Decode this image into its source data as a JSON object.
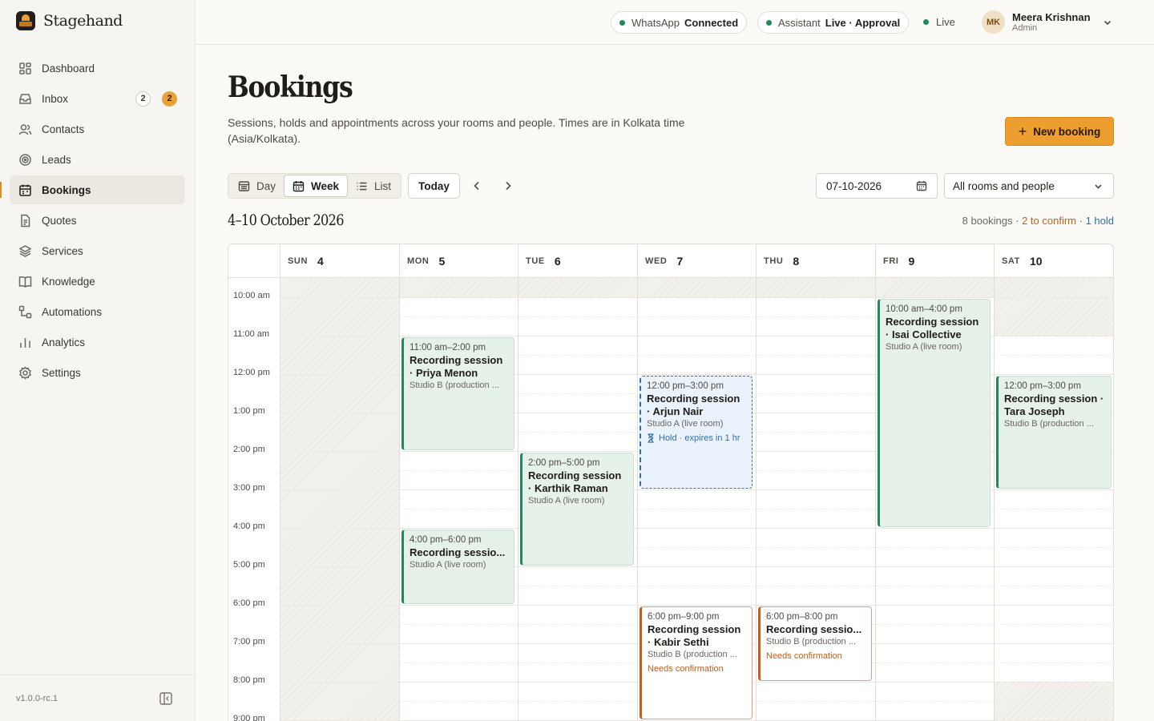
{
  "app": {
    "name": "Stagehand",
    "version": "v1.0.0-rc.1"
  },
  "sidebar": {
    "items": [
      {
        "label": "Dashboard",
        "icon": "dashboard-icon"
      },
      {
        "label": "Inbox",
        "icon": "inbox-icon",
        "badges": [
          "2",
          "2"
        ]
      },
      {
        "label": "Contacts",
        "icon": "contacts-icon"
      },
      {
        "label": "Leads",
        "icon": "target-icon"
      },
      {
        "label": "Bookings",
        "icon": "calendar-icon",
        "active": true
      },
      {
        "label": "Quotes",
        "icon": "document-icon"
      },
      {
        "label": "Services",
        "icon": "layers-icon"
      },
      {
        "label": "Knowledge",
        "icon": "book-icon"
      },
      {
        "label": "Automations",
        "icon": "automation-icon"
      },
      {
        "label": "Analytics",
        "icon": "bar-chart-icon"
      },
      {
        "label": "Settings",
        "icon": "gear-icon"
      }
    ]
  },
  "topbar": {
    "whatsapp": {
      "label": "WhatsApp",
      "status": "Connected"
    },
    "assistant": {
      "label": "Assistant",
      "status": "Live · Approval"
    },
    "live": "Live",
    "user": {
      "initials": "MK",
      "name": "Meera Krishnan",
      "role": "Admin"
    }
  },
  "header": {
    "title": "Bookings",
    "description": "Sessions, holds and appointments across your rooms and people. Times are in Kolkata time (Asia/Kolkata).",
    "new_button": "New booking"
  },
  "toolbar": {
    "views": [
      "Day",
      "Week",
      "List"
    ],
    "active_view": "Week",
    "today": "Today",
    "date_value": "07-10-2026",
    "room_filter": "All rooms and people"
  },
  "range": {
    "title": "4–10 October 2026",
    "summary": {
      "bookings": "8 bookings",
      "sep1": " · ",
      "confirm": "2 to confirm",
      "sep2": " · ",
      "hold": "1 hold"
    }
  },
  "calendar": {
    "days": [
      {
        "name": "SUN",
        "num": "4"
      },
      {
        "name": "MON",
        "num": "5"
      },
      {
        "name": "TUE",
        "num": "6"
      },
      {
        "name": "WED",
        "num": "7"
      },
      {
        "name": "THU",
        "num": "8"
      },
      {
        "name": "FRI",
        "num": "9"
      },
      {
        "name": "SAT",
        "num": "10"
      }
    ],
    "hours": [
      "10:00 am",
      "11:00 am",
      "12:00 pm",
      "1:00 pm",
      "2:00 pm",
      "3:00 pm",
      "4:00 pm",
      "5:00 pm",
      "6:00 pm",
      "7:00 pm",
      "8:00 pm",
      "9:00 pm"
    ],
    "events": [
      {
        "time": "11:00 am–2:00 pm",
        "title": "Recording session · Priya Menon",
        "room": "Studio B (production ...",
        "status": "confirmed"
      },
      {
        "time": "4:00 pm–6:00 pm",
        "title": "Recording sessio...",
        "room": "Studio A (live room)",
        "status": "confirmed"
      },
      {
        "time": "2:00 pm–5:00 pm",
        "title": "Recording session · Karthik Raman",
        "room": "Studio A (live room)",
        "status": "confirmed"
      },
      {
        "time": "12:00 pm–3:00 pm",
        "title": "Recording session · Arjun Nair",
        "room": "Studio A (live room)",
        "status": "hold",
        "note": "Hold · expires in 1 hr"
      },
      {
        "time": "6:00 pm–9:00 pm",
        "title": "Recording session · Kabir Sethi",
        "room": "Studio B (production ...",
        "status": "pending",
        "note": "Needs confirmation"
      },
      {
        "time": "6:00 pm–8:00 pm",
        "title": "Recording sessio...",
        "room": "Studio B (production ...",
        "status": "pending",
        "note": "Needs confirmation"
      },
      {
        "time": "10:00 am–4:00 pm",
        "title": "Recording session · Isai Collective",
        "room": "Studio A (live room)",
        "status": "confirmed"
      },
      {
        "time": "12:00 pm–3:00 pm",
        "title": "Recording session · Tara Joseph",
        "room": "Studio B (production ...",
        "status": "confirmed"
      }
    ]
  },
  "colors": {
    "accent": "#ec9f2e",
    "confirmed": "#1e8a5a",
    "pending": "#c0601c",
    "hold": "#2f6fae"
  }
}
